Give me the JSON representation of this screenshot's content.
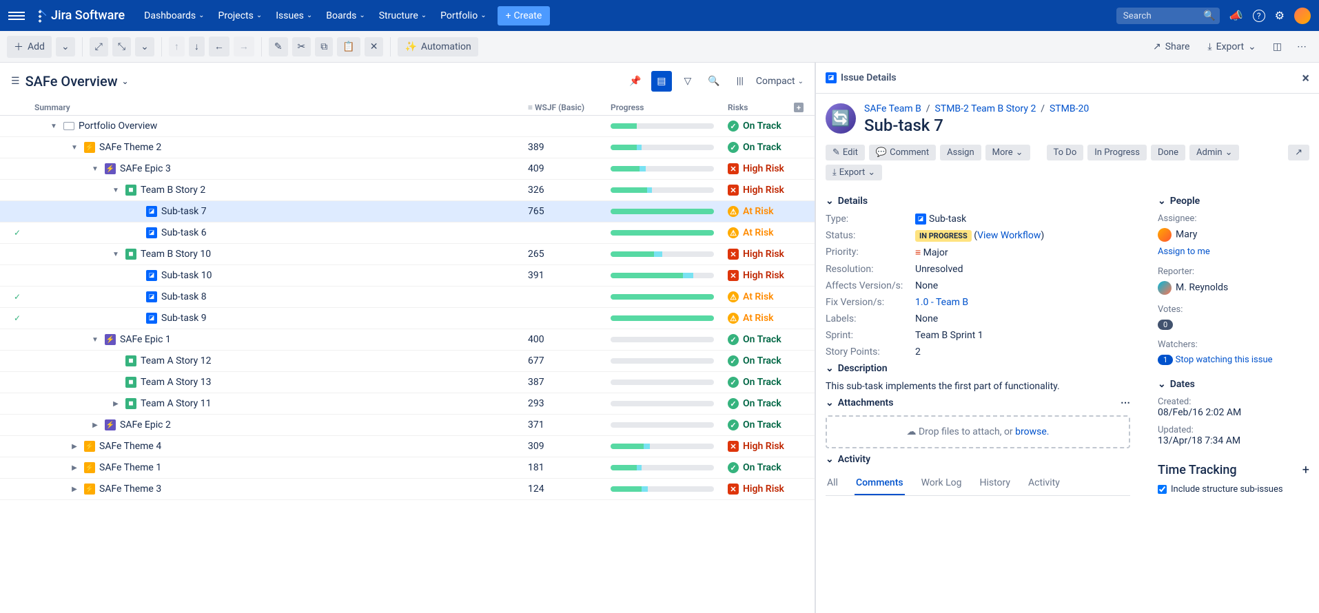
{
  "topnav": {
    "logo": "Jira Software",
    "items": [
      "Dashboards",
      "Projects",
      "Issues",
      "Boards",
      "Structure",
      "Portfolio"
    ],
    "create": "Create",
    "search_placeholder": "Search"
  },
  "toolbar": {
    "add": "Add",
    "automation": "Automation",
    "share": "Share",
    "export": "Export"
  },
  "structure": {
    "title": "SAFe Overview",
    "compact": "Compact",
    "columns": {
      "summary": "Summary",
      "wsjf": "WSJF (Basic)",
      "progress": "Progress",
      "risks": "Risks"
    }
  },
  "rows": [
    {
      "indent": 0,
      "type": "folder",
      "label": "Portfolio Overview",
      "wsjf": "",
      "progress": [
        25,
        0
      ],
      "risk": "ok",
      "risk_label": "On Track",
      "chk": "",
      "exp": "▼"
    },
    {
      "indent": 1,
      "type": "theme",
      "label": "SAFe Theme 2",
      "wsjf": "389",
      "progress": [
        25,
        5
      ],
      "risk": "ok",
      "risk_label": "On Track",
      "chk": "",
      "exp": "▼"
    },
    {
      "indent": 2,
      "type": "epic",
      "label": "SAFe Epic 3",
      "wsjf": "409",
      "progress": [
        28,
        6
      ],
      "risk": "high",
      "risk_label": "High Risk",
      "chk": "",
      "exp": "▼"
    },
    {
      "indent": 3,
      "type": "story",
      "label": "Team B Story 2",
      "wsjf": "326",
      "progress": [
        35,
        5
      ],
      "risk": "high",
      "risk_label": "High Risk",
      "chk": "",
      "exp": "▼"
    },
    {
      "indent": 4,
      "type": "subtask",
      "label": "Sub-task 7",
      "wsjf": "765",
      "progress": [
        100,
        0
      ],
      "risk": "at",
      "risk_label": "At Risk",
      "chk": "",
      "exp": "",
      "selected": true
    },
    {
      "indent": 4,
      "type": "subtask",
      "label": "Sub-task 6",
      "wsjf": "",
      "progress": [
        100,
        0
      ],
      "risk": "at",
      "risk_label": "At Risk",
      "chk": "✓",
      "exp": ""
    },
    {
      "indent": 3,
      "type": "story",
      "label": "Team B Story 10",
      "wsjf": "265",
      "progress": [
        42,
        8
      ],
      "risk": "high",
      "risk_label": "High Risk",
      "chk": "",
      "exp": "▼"
    },
    {
      "indent": 4,
      "type": "subtask",
      "label": "Sub-task 10",
      "wsjf": "391",
      "progress": [
        70,
        10
      ],
      "risk": "high",
      "risk_label": "High Risk",
      "chk": "",
      "exp": ""
    },
    {
      "indent": 4,
      "type": "subtask",
      "label": "Sub-task 8",
      "wsjf": "",
      "progress": [
        100,
        0
      ],
      "risk": "at",
      "risk_label": "At Risk",
      "chk": "✓",
      "exp": ""
    },
    {
      "indent": 4,
      "type": "subtask",
      "label": "Sub-task 9",
      "wsjf": "",
      "progress": [
        100,
        0
      ],
      "risk": "at",
      "risk_label": "At Risk",
      "chk": "✓",
      "exp": ""
    },
    {
      "indent": 2,
      "type": "epic",
      "label": "SAFe Epic 1",
      "wsjf": "400",
      "progress": [
        0,
        0
      ],
      "risk": "ok",
      "risk_label": "On Track",
      "chk": "",
      "exp": "▼"
    },
    {
      "indent": 3,
      "type": "story",
      "label": "Team A Story 12",
      "wsjf": "677",
      "progress": [
        0,
        0
      ],
      "risk": "ok",
      "risk_label": "On Track",
      "chk": "",
      "exp": ""
    },
    {
      "indent": 3,
      "type": "story",
      "label": "Team A Story 13",
      "wsjf": "387",
      "progress": [
        0,
        0
      ],
      "risk": "ok",
      "risk_label": "On Track",
      "chk": "",
      "exp": ""
    },
    {
      "indent": 3,
      "type": "story",
      "label": "Team A Story 11",
      "wsjf": "293",
      "progress": [
        0,
        0
      ],
      "risk": "ok",
      "risk_label": "On Track",
      "chk": "",
      "exp": "▶"
    },
    {
      "indent": 2,
      "type": "epic",
      "label": "SAFe Epic 2",
      "wsjf": "371",
      "progress": [
        0,
        0
      ],
      "risk": "ok",
      "risk_label": "On Track",
      "chk": "",
      "exp": "▶"
    },
    {
      "indent": 1,
      "type": "theme",
      "label": "SAFe Theme 4",
      "wsjf": "309",
      "progress": [
        32,
        6
      ],
      "risk": "high",
      "risk_label": "High Risk",
      "chk": "",
      "exp": "▶"
    },
    {
      "indent": 1,
      "type": "theme",
      "label": "SAFe Theme 1",
      "wsjf": "181",
      "progress": [
        25,
        5
      ],
      "risk": "ok",
      "risk_label": "On Track",
      "chk": "",
      "exp": "▶"
    },
    {
      "indent": 1,
      "type": "theme",
      "label": "SAFe Theme 3",
      "wsjf": "124",
      "progress": [
        30,
        6
      ],
      "risk": "high",
      "risk_label": "High Risk",
      "chk": "",
      "exp": "▶"
    }
  ],
  "panel": {
    "header": "Issue Details",
    "breadcrumbs": [
      {
        "text": "SAFe Team B"
      },
      {
        "text": "STMB-2 Team B Story 2"
      },
      {
        "text": "STMB-20"
      }
    ],
    "title": "Sub-task 7",
    "actions": {
      "edit": "Edit",
      "comment": "Comment",
      "assign": "Assign",
      "more": "More",
      "todo": "To Do",
      "inprogress": "In Progress",
      "done": "Done",
      "admin": "Admin",
      "export": "Export"
    },
    "details_hdr": "Details",
    "details": {
      "type_k": "Type:",
      "type_v": "Sub-task",
      "status_k": "Status:",
      "status_v": "IN PROGRESS",
      "status_link": "View Workflow",
      "priority_k": "Priority:",
      "priority_v": "Major",
      "resolution_k": "Resolution:",
      "resolution_v": "Unresolved",
      "affects_k": "Affects Version/s:",
      "affects_v": "None",
      "fix_k": "Fix Version/s:",
      "fix_v": "1.0 - Team B",
      "labels_k": "Labels:",
      "labels_v": "None",
      "sprint_k": "Sprint:",
      "sprint_v": "Team B Sprint 1",
      "sp_k": "Story Points:",
      "sp_v": "2"
    },
    "people_hdr": "People",
    "people": {
      "assignee_k": "Assignee:",
      "assignee_v": "Mary",
      "assign_me": "Assign to me",
      "reporter_k": "Reporter:",
      "reporter_v": "M. Reynolds",
      "votes_k": "Votes:",
      "votes_v": "0",
      "watchers_k": "Watchers:",
      "watch_badge": "1",
      "watch_stop": "Stop watching this issue"
    },
    "desc_hdr": "Description",
    "desc": "This sub-task implements the first part of functionality.",
    "attach_hdr": "Attachments",
    "attach_drop": "Drop files to attach, or ",
    "attach_browse": "browse.",
    "activity_hdr": "Activity",
    "tabs": [
      "All",
      "Comments",
      "Work Log",
      "History",
      "Activity"
    ],
    "active_tab": 1,
    "dates_hdr": "Dates",
    "dates": {
      "created_k": "Created:",
      "created_v": "08/Feb/16 2:02 AM",
      "updated_k": "Updated:",
      "updated_v": "13/Apr/18 7:34 AM"
    },
    "tt_hdr": "Time Tracking",
    "tt_check": "Include structure sub-issues"
  }
}
